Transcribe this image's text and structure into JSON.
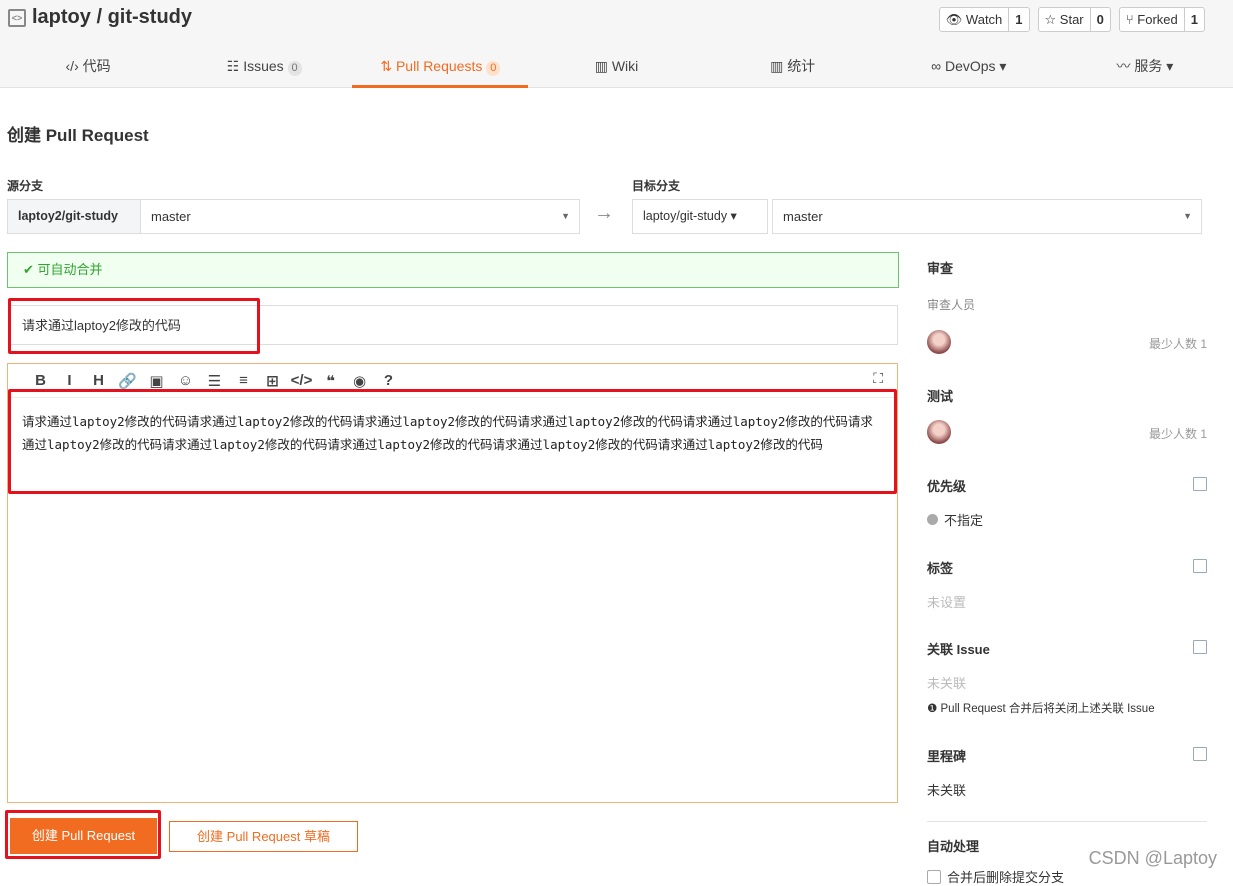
{
  "repo": {
    "title": "laptoy / git-study"
  },
  "actions": [
    {
      "label": "Watch",
      "count": "1",
      "icon": "eye-icon"
    },
    {
      "label": "Star",
      "count": "0",
      "icon": "star-icon"
    },
    {
      "label": "Forked",
      "count": "1",
      "icon": "fork-icon"
    }
  ],
  "tabs": [
    {
      "label": "代码",
      "icon": "code-icon"
    },
    {
      "label": "Issues",
      "badge": "0",
      "icon": "issues-icon"
    },
    {
      "label": "Pull Requests",
      "badge": "0",
      "icon": "pull-request-icon",
      "active": true
    },
    {
      "label": "Wiki",
      "icon": "book-icon"
    },
    {
      "label": "统计",
      "icon": "chart-icon"
    },
    {
      "label": "DevOps ▾",
      "icon": "infinity-icon"
    },
    {
      "label": "服务 ▾",
      "icon": "pulse-icon"
    }
  ],
  "page": {
    "heading": "创建 Pull Request"
  },
  "source": {
    "label": "源分支",
    "repo": "laptoy2/git-study",
    "branch": "master"
  },
  "target": {
    "label": "目标分支",
    "repo": "laptoy/git-study ▾",
    "branch": "master"
  },
  "merge_status": "可自动合并",
  "form": {
    "title": "请求通过laptoy2修改的代码",
    "body": "请求通过laptoy2修改的代码请求通过laptoy2修改的代码请求通过laptoy2修改的代码请求通过laptoy2修改的代码请求通过laptoy2修改的代码请求通过laptoy2修改的代码请求通过laptoy2修改的代码请求通过laptoy2修改的代码请求通过laptoy2修改的代码请求通过laptoy2修改的代码"
  },
  "toolbar": [
    "B",
    "I",
    "H",
    "🔗",
    "▣",
    "☺",
    "☰",
    "≡",
    "⊞",
    "</>",
    "❝",
    "◉",
    "?"
  ],
  "buttons": {
    "create": "创建 Pull Request",
    "draft": "创建 Pull Request 草稿"
  },
  "sidebar": {
    "review": {
      "title": "审查",
      "sub": "审查人员",
      "min": "最少人数 1"
    },
    "test": {
      "title": "测试",
      "min": "最少人数 1"
    },
    "priority": {
      "title": "优先级",
      "value": "不指定"
    },
    "labels": {
      "title": "标签",
      "value": "未设置"
    },
    "issue": {
      "title": "关联 Issue",
      "value": "未关联",
      "note": "Pull Request 合并后将关闭上述关联 Issue"
    },
    "milestone": {
      "title": "里程碑",
      "value": "未关联"
    },
    "auto": {
      "title": "自动处理",
      "option": "合并后删除提交分支"
    }
  },
  "watermark": "CSDN @Laptoy",
  "colors": {
    "accent": "#f16c20",
    "success": "#2fa52f",
    "highlight": "#e5121d"
  }
}
